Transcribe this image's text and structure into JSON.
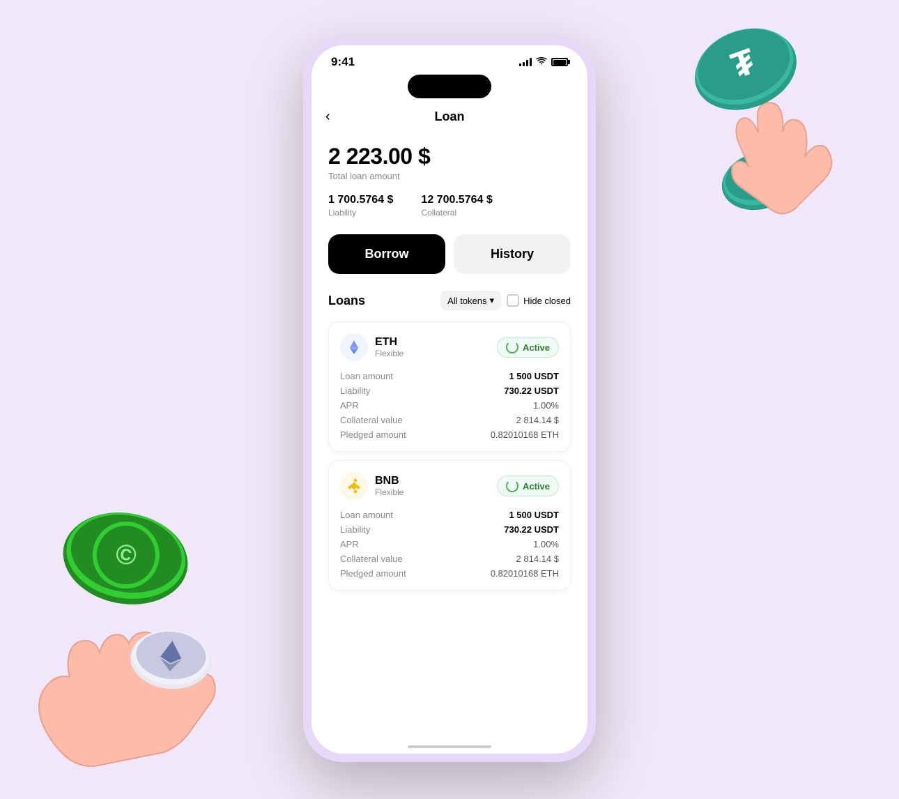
{
  "phone": {
    "status_bar": {
      "time": "9:41",
      "signal": "signal",
      "wifi": "wifi",
      "battery": "battery"
    },
    "nav": {
      "back_label": "‹",
      "title": "Loan"
    },
    "summary": {
      "total_amount": "2 223.00 $",
      "total_label": "Total loan amount",
      "liability_value": "1 700.5764 $",
      "liability_label": "Liability",
      "collateral_value": "12 700.5764 $",
      "collateral_label": "Collateral"
    },
    "tabs": {
      "borrow_label": "Borrow",
      "history_label": "History",
      "active_tab": "borrow"
    },
    "loans_section": {
      "title": "Loans",
      "filter_label": "All tokens",
      "hide_closed_label": "Hide closed"
    },
    "loans": [
      {
        "coin": "ETH",
        "type": "Flexible",
        "status": "Active",
        "loan_amount_label": "Loan amount",
        "loan_amount_value": "1 500 USDT",
        "liability_label": "Liability",
        "liability_value": "730.22 USDT",
        "apr_label": "APR",
        "apr_value": "1.00%",
        "collateral_value_label": "Collateral value",
        "collateral_value_val": "2 814.14 $",
        "pledged_label": "Pledged amount",
        "pledged_value": "0.82010168 ETH"
      },
      {
        "coin": "BNB",
        "type": "Flexible",
        "status": "Active",
        "loan_amount_label": "Loan amount",
        "loan_amount_value": "1 500 USDT",
        "liability_label": "Liability",
        "liability_value": "730.22 USDT",
        "apr_label": "APR",
        "apr_value": "1.00%",
        "collateral_value_label": "Collateral value",
        "collateral_value_val": "2 814.14 $",
        "pledged_label": "Pledged amount",
        "pledged_value": "0.82010168 ETH"
      }
    ]
  }
}
